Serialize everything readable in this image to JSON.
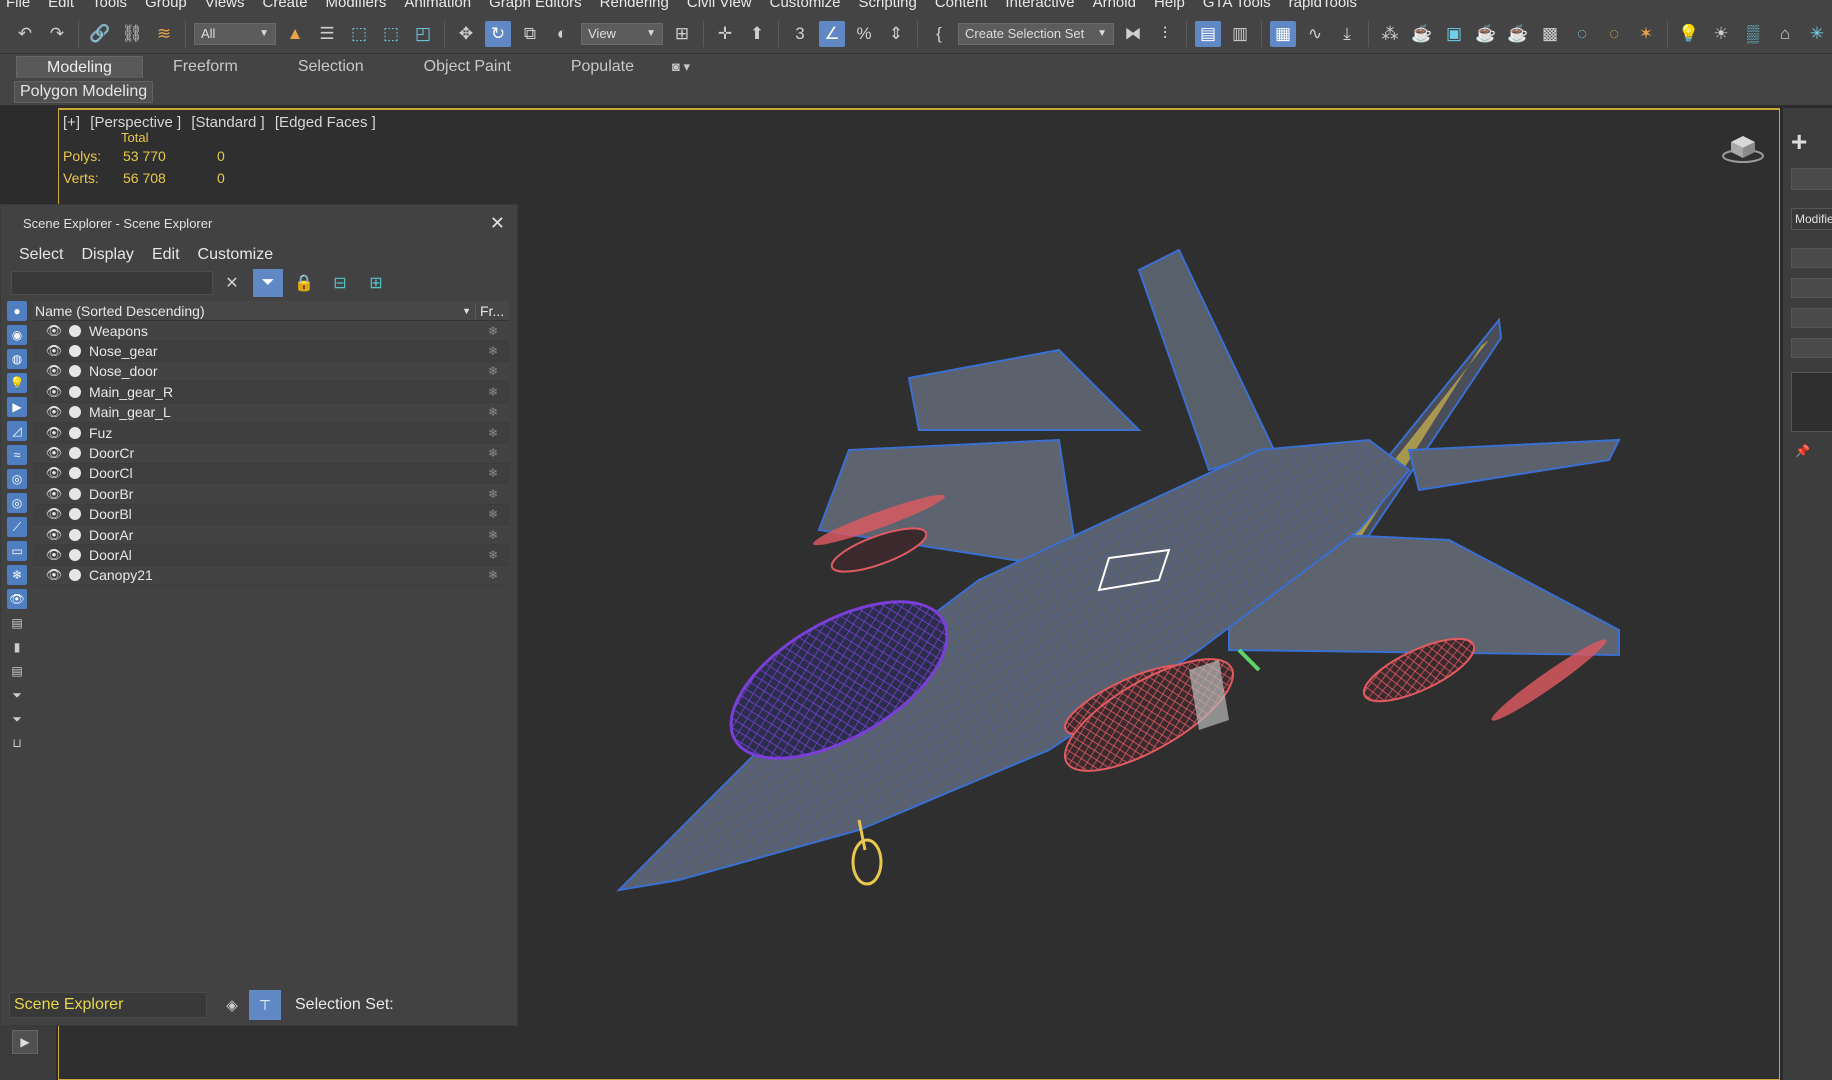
{
  "menubar": {
    "items": [
      "File",
      "Edit",
      "Tools",
      "Group",
      "Views",
      "Create",
      "Modifiers",
      "Animation",
      "Graph Editors",
      "Rendering",
      "Civil View",
      "Customize",
      "Scripting",
      "Content",
      "Interactive",
      "Arnold",
      "Help",
      "GTA Tools",
      "rapidTools"
    ]
  },
  "toolbar": {
    "filter_value": "All",
    "ref_coord_value": "View",
    "selection_set_placeholder": "Create Selection Set"
  },
  "ribbon": {
    "tabs": [
      "Modeling",
      "Freeform",
      "Selection",
      "Object Paint",
      "Populate"
    ],
    "active_tab": "Modeling",
    "panel_label": "Polygon Modeling"
  },
  "viewport": {
    "label_plus": "[+]",
    "label_view": "[Perspective ]",
    "label_shading": "[Standard ]",
    "label_edges": "[Edged Faces ]",
    "stats": {
      "total_label": "Total",
      "polys_label": "Polys:",
      "polys_total": "53 770",
      "polys_selected": "0",
      "verts_label": "Verts:",
      "verts_total": "56 708",
      "verts_selected": "0"
    }
  },
  "scene_explorer": {
    "title": "Scene Explorer - Scene Explorer",
    "menu": [
      "Select",
      "Display",
      "Edit",
      "Customize"
    ],
    "column_name": "Name (Sorted Descending)",
    "column_freeze": "Fr...",
    "objects": [
      "Weapons",
      "Nose_gear",
      "Nose_door",
      "Main_gear_R",
      "Main_gear_L",
      "Fuz",
      "DoorCr",
      "DoorCl",
      "DoorBr",
      "DoorBl",
      "DoorAr",
      "DoorAl",
      "Canopy21"
    ],
    "footer_name": "Scene Explorer",
    "selection_set_label": "Selection Set:"
  },
  "command_panel": {
    "modifier_label": "Modifier List"
  },
  "colors": {
    "accent": "#5f88c4",
    "viewport_border": "#c9a83a",
    "stats_text": "#e8c84a",
    "wire_blue": "#3b6fd0",
    "wire_purple": "#7a3fd6",
    "wire_red": "#e05a62",
    "wire_yellow": "#e8c84a"
  }
}
